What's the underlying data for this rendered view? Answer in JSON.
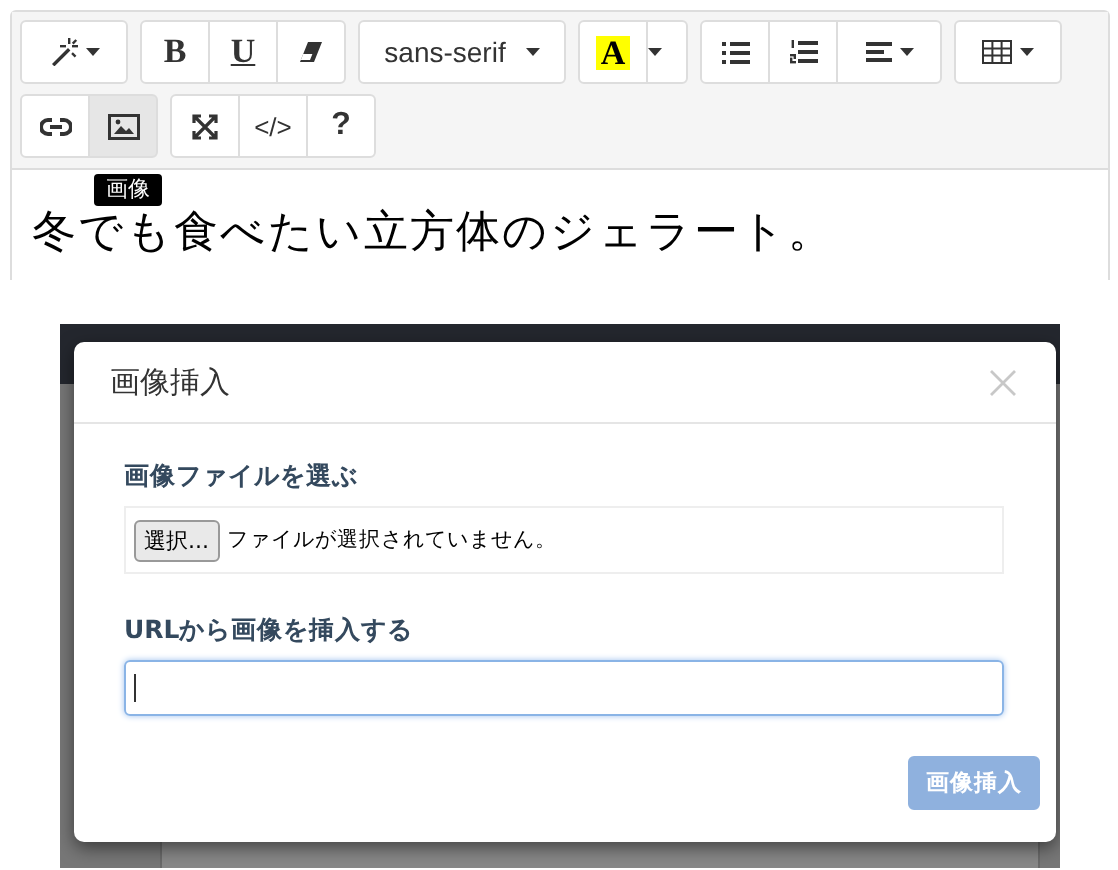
{
  "editor": {
    "toolbar": [
      [
        {
          "kind": "wand",
          "active": false
        },
        {
          "kind": "bold",
          "label": "B",
          "active": false
        },
        {
          "kind": "underline",
          "label": "U",
          "active": false
        },
        {
          "kind": "eraser",
          "active": false
        },
        {
          "kind": "font",
          "label": "sans-serif",
          "active": false
        },
        {
          "kind": "color",
          "label": "A",
          "color": "#ffff00",
          "active": false
        },
        {
          "kind": "caret",
          "active": false
        },
        {
          "kind": "ul",
          "active": false
        },
        {
          "kind": "ol",
          "active": false
        },
        {
          "kind": "align",
          "active": false
        },
        {
          "kind": "table",
          "active": false
        }
      ],
      [
        {
          "kind": "link",
          "active": false
        },
        {
          "kind": "image",
          "active": true
        },
        {
          "kind": "fullscreen",
          "active": false
        },
        {
          "kind": "code",
          "label": "</>",
          "active": false
        },
        {
          "kind": "help",
          "label": "?",
          "active": false
        }
      ]
    ],
    "tooltip": "画像",
    "content": "冬でも食べたい立方体のジェラート。"
  },
  "dialog": {
    "title": "画像挿入",
    "file_label": "画像ファイルを選ぶ",
    "file_button": "選択...",
    "file_status": "ファイルが選択されていません。",
    "url_label": "URLから画像を挿入する",
    "url_focused": true,
    "submit": {
      "label": "画像挿入",
      "disabled": true
    }
  }
}
